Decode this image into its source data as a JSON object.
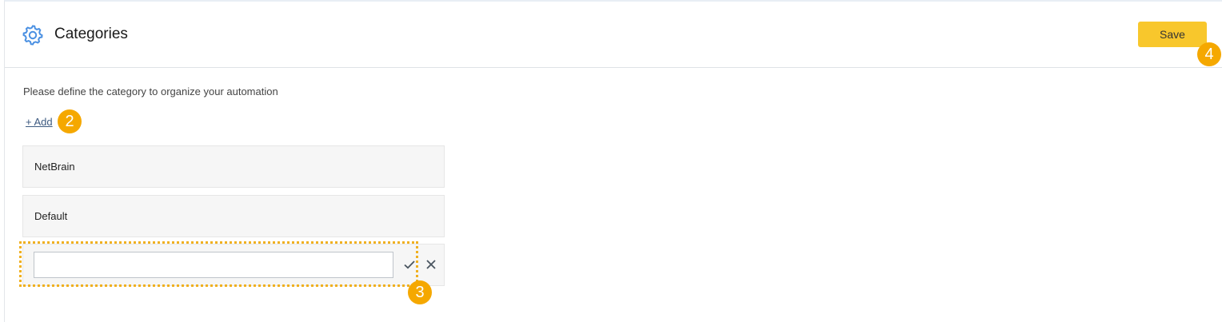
{
  "header": {
    "title": "Categories",
    "save_label": "Save",
    "icon": "gear-icon"
  },
  "main": {
    "description": "Please define the category to organize your automation",
    "add_label": "+ Add",
    "categories": [
      {
        "name": "NetBrain"
      },
      {
        "name": "Default"
      }
    ],
    "new_category": {
      "value": "",
      "placeholder": ""
    }
  },
  "callouts": {
    "add": "2",
    "new_row": "3",
    "save": "4"
  },
  "colors": {
    "accent": "#f8c72c",
    "callout": "#f5a800",
    "icon_blue": "#4a90e2",
    "link": "#3d5a80"
  }
}
